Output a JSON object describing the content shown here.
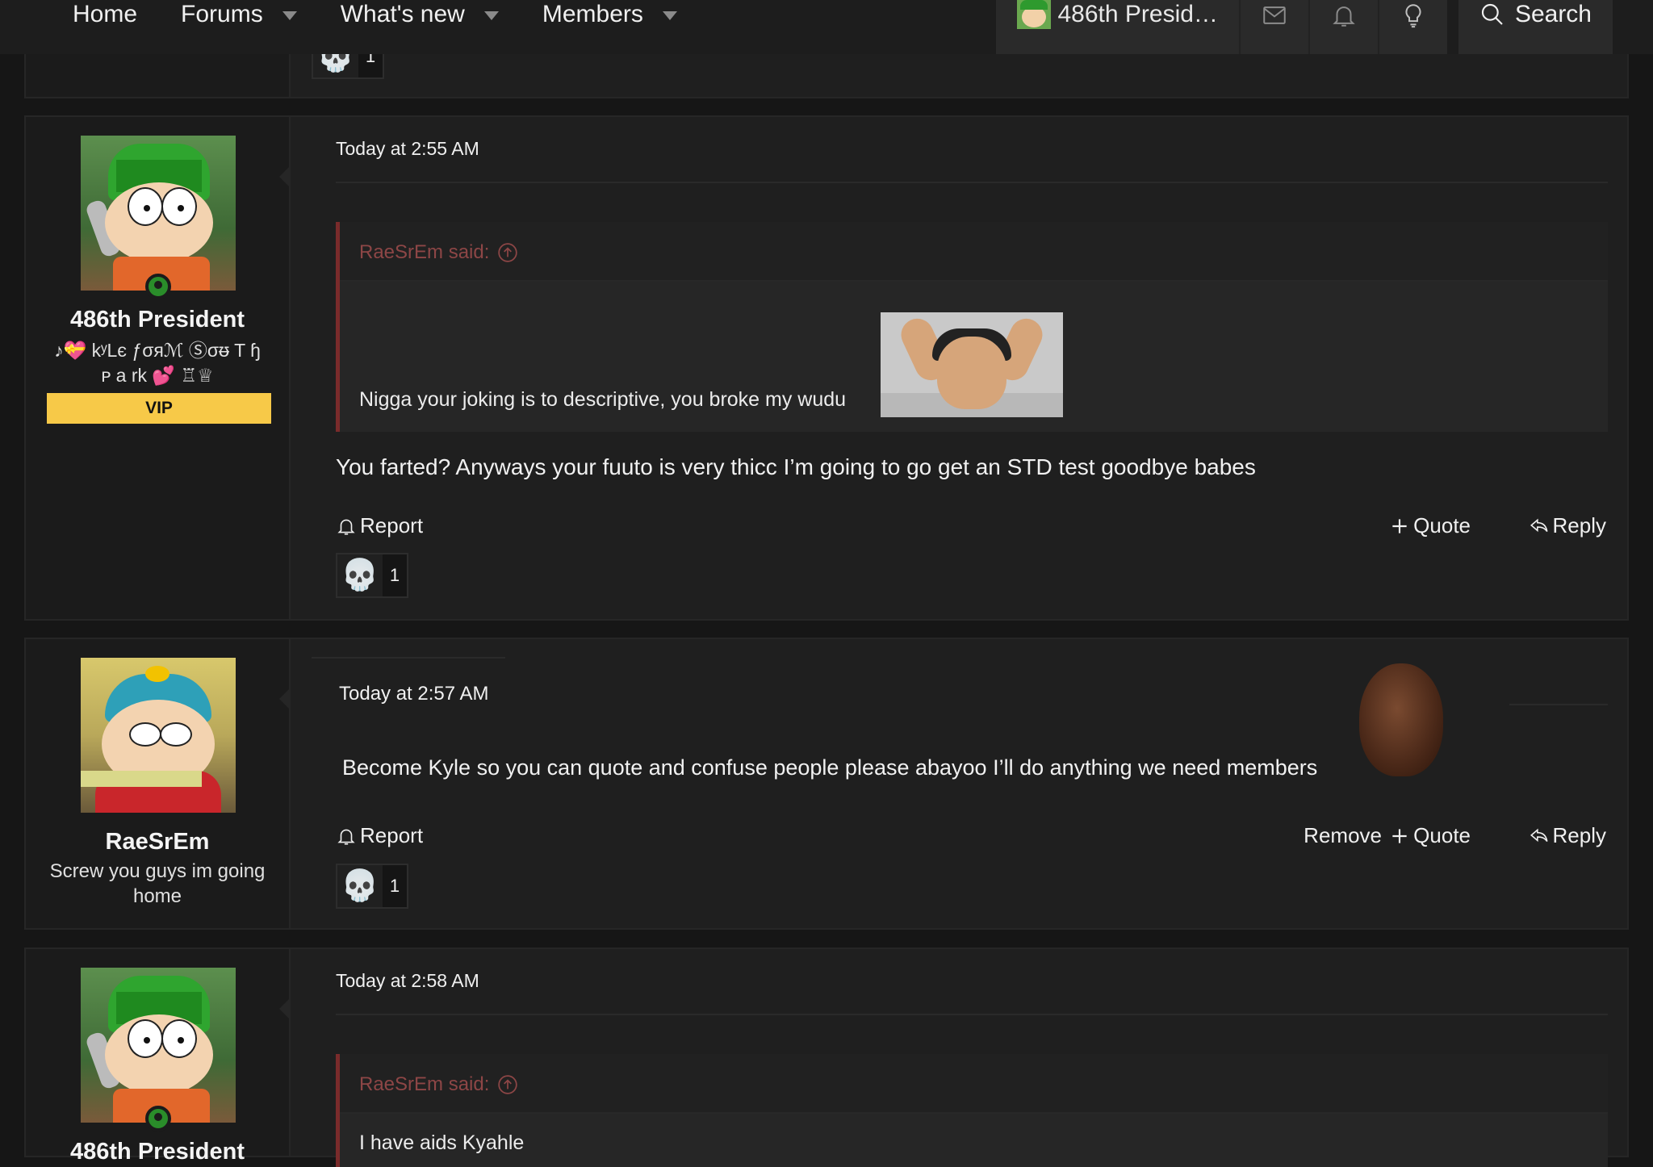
{
  "nav": {
    "items": [
      {
        "label": "Home",
        "has_caret": false
      },
      {
        "label": "Forums",
        "has_caret": true
      },
      {
        "label": "What's new",
        "has_caret": true
      },
      {
        "label": "Members",
        "has_caret": true
      }
    ],
    "user_label": "486th Presid…",
    "search_label": "Search"
  },
  "top_reaction": {
    "count": "1"
  },
  "posts": [
    {
      "time": "Today at 2:55 AM",
      "username": "486th President",
      "user_title_line1": "♪💝 kʸLє ƒσяℳ Ⓢσᵿ T ɧ",
      "user_title_line2": "ᴘ a rk 💕 ♖♕",
      "badge": "VIP",
      "quote_author": "RaeSrEm said:",
      "quote_text": "Nigga your joking is to descriptive, you broke my wudu",
      "body": "You farted? Anyways your fuuto is very thicc I’m going to go get an STD test goodbye babes",
      "report_label": "Report",
      "quote_label": "Quote",
      "reply_label": "Reply",
      "reaction_count": "1"
    },
    {
      "time": "Today at 2:57 AM",
      "username": "RaeSrEm",
      "user_title": "Screw you guys im going home",
      "body": "Become Kyle so you can quote and confuse people please abayoo I’ll do anything we need members",
      "report_label": "Report",
      "remove_label": "Remove",
      "quote_label": "Quote",
      "reply_label": "Reply",
      "reaction_count": "1"
    },
    {
      "time": "Today at 2:58 AM",
      "username": "486th President",
      "quote_author": "RaeSrEm said:",
      "quote_text": "I have aids Kyahle"
    }
  ],
  "colors": {
    "background": "#161616",
    "post_bg": "#1f1f1f",
    "vip_badge": "#f7c948",
    "quote_border": "#7a2b2b",
    "quote_author": "#8d4646",
    "online": "#2a8d2a"
  }
}
